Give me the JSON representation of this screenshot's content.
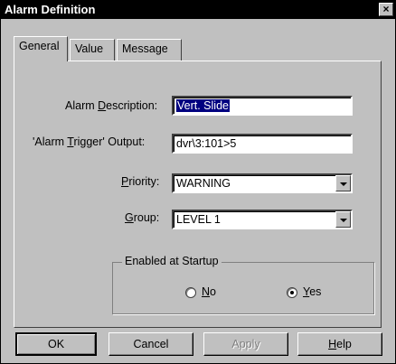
{
  "window": {
    "title": "Alarm Definition",
    "close_glyph": "×"
  },
  "tabs": [
    {
      "label": "General",
      "active": true
    },
    {
      "label": "Value",
      "active": false
    },
    {
      "label": "Message",
      "active": false
    }
  ],
  "form": {
    "description": {
      "label_pre": "Alarm ",
      "label_key": "D",
      "label_post": "escription:",
      "value": "Vert. Slide"
    },
    "trigger": {
      "label_pre": "'Alarm ",
      "label_key": "T",
      "label_post": "rigger' Output:",
      "value": "dvr\\3:101>5"
    },
    "priority": {
      "label_pre": "",
      "label_key": "P",
      "label_post": "riority:",
      "value": "WARNING"
    },
    "group": {
      "label_pre": "",
      "label_key": "G",
      "label_post": "roup:",
      "value": "LEVEL 1"
    }
  },
  "enabled_at_startup": {
    "legend": "Enabled at Startup",
    "options": [
      {
        "key": "N",
        "rest": "o",
        "selected": false
      },
      {
        "key": "Y",
        "rest": "es",
        "selected": true
      }
    ]
  },
  "buttons": {
    "ok": "OK",
    "cancel": "Cancel",
    "apply": "Apply",
    "help_key": "H",
    "help_rest": "elp"
  }
}
